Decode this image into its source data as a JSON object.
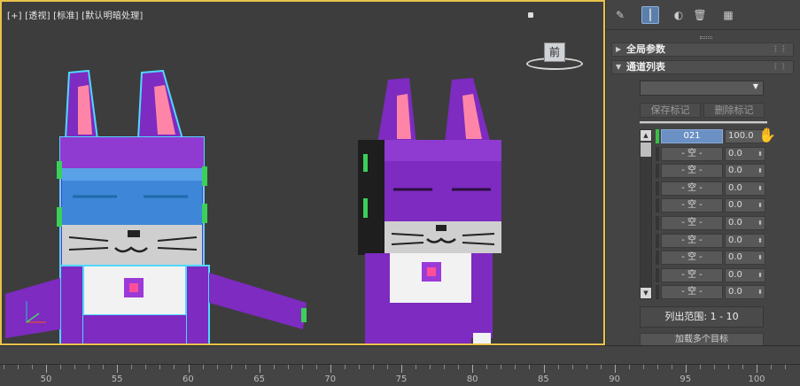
{
  "viewport": {
    "label": "[+] [透视] [标准] [默认明暗处理]",
    "viewcube_face": "前",
    "border_color": "#e8c34a"
  },
  "toolbar": {
    "icons": [
      "pin-icon",
      "active-modifier-icon",
      "show-result-icon",
      "trash-icon",
      "configure-icon"
    ]
  },
  "rollouts": {
    "global_params": "全局参数",
    "channel_list": "通道列表"
  },
  "buttons": {
    "save_marker": "保存标记",
    "delete_marker": "删除标记"
  },
  "channels": [
    {
      "name": "021",
      "value": "100.0",
      "selected": true,
      "active": true
    },
    {
      "name": "- 空 -",
      "value": "0.0"
    },
    {
      "name": "- 空 -",
      "value": "0.0"
    },
    {
      "name": "- 空 -",
      "value": "0.0"
    },
    {
      "name": "- 空 -",
      "value": "0.0"
    },
    {
      "name": "- 空 -",
      "value": "0.0"
    },
    {
      "name": "- 空 -",
      "value": "0.0"
    },
    {
      "name": "- 空 -",
      "value": "0.0"
    },
    {
      "name": "- 空 -",
      "value": "0.0"
    },
    {
      "name": "- 空 -",
      "value": "0.0"
    }
  ],
  "range": {
    "label": "列出范围:",
    "value": "1 - 10"
  },
  "cut_button": "加载多个目标",
  "timeline": {
    "labels": [
      "50",
      "55",
      "60",
      "65",
      "70",
      "75",
      "80",
      "85",
      "90",
      "95",
      "100"
    ]
  },
  "colors": {
    "cat_purple": "#7d2bc0",
    "selection_cyan": "#4fd8ff",
    "visor_blue": "#3d86d8",
    "active_green": "#38c048"
  }
}
